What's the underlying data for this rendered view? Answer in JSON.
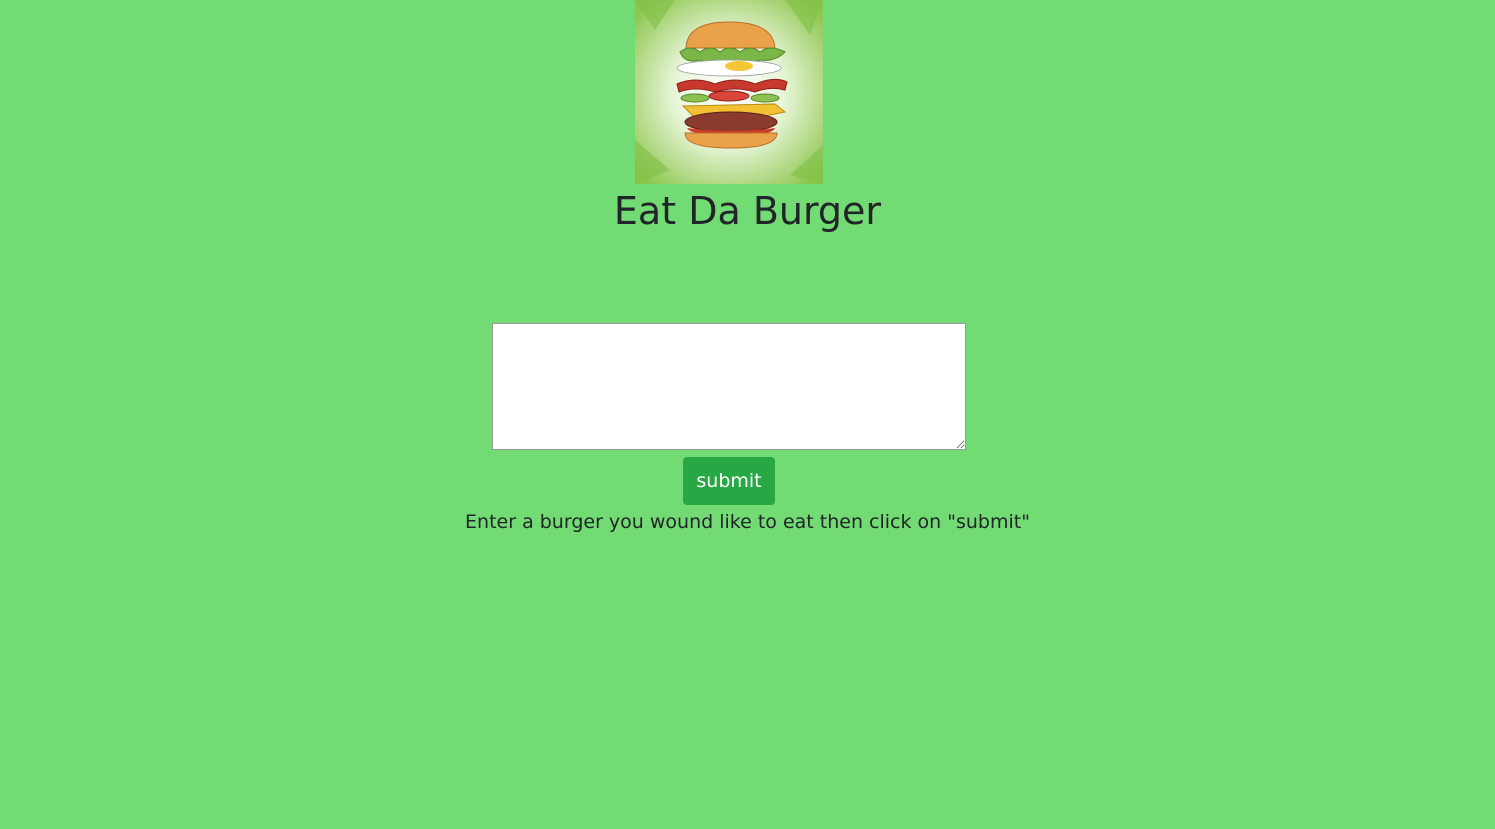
{
  "header": {
    "logo_icon": "burger-logo-icon",
    "title": "Eat Da Burger"
  },
  "form": {
    "input_value": "",
    "input_placeholder": "",
    "submit_label": "submit",
    "hint": "Enter a burger you wound like to eat then click on \"submit\""
  },
  "colors": {
    "background": "#72db73",
    "button": "#28a745",
    "text": "#212529"
  }
}
